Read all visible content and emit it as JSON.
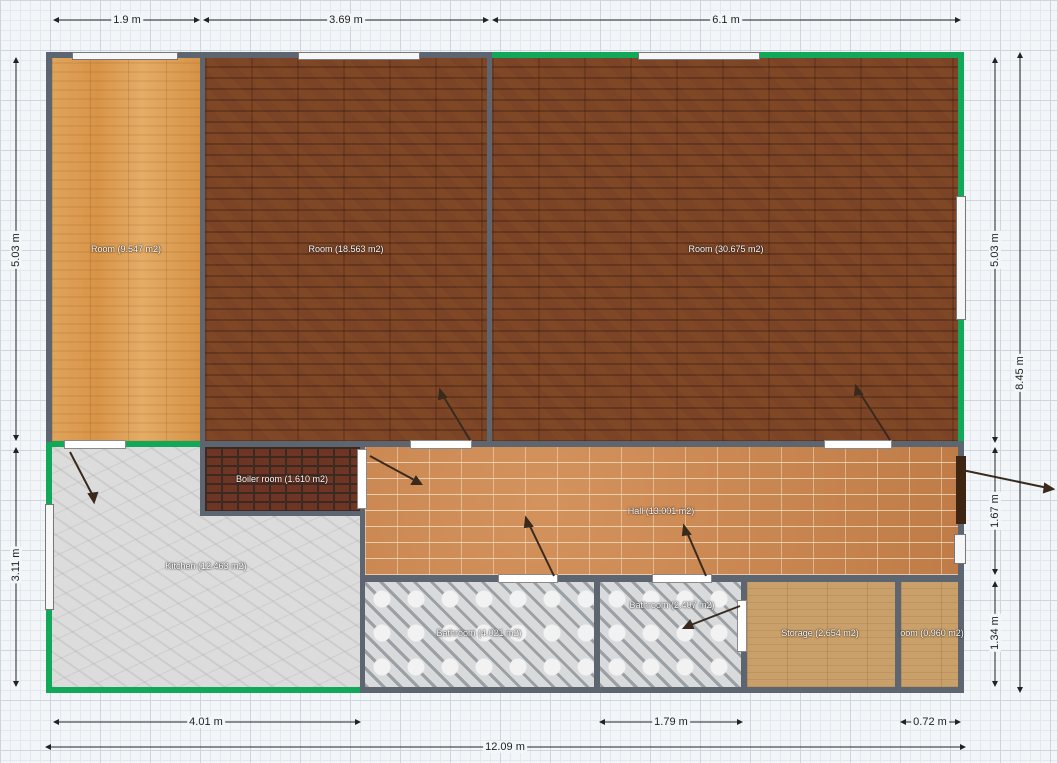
{
  "rooms": {
    "room_left": "Room (9.547 m2)",
    "room_middle": "Room (18.563 m2)",
    "room_right": "Room (30.675 m2)",
    "boiler": "Boiler room (1.610 m2)",
    "hall": "Hall (13.001 m2)",
    "kitchen": "Kitchen (12.463 m2)",
    "bathroom_1": "Bathroom (4.021 m2)",
    "bathroom_2": "Bathroom (2.407 m2)",
    "storage": "Storage (2.654 m2)",
    "room_small": "oom (0.960 m2)"
  },
  "dimensions": {
    "top_1": "1.9 m",
    "top_2": "3.69 m",
    "top_3": "6.1 m",
    "left_upper": "5.03 m",
    "left_lower": "3.11 m",
    "right_upper": "5.03 m",
    "right_total": "8.45 m",
    "right_hall": "1.67 m",
    "right_lower": "1.34 m",
    "bottom_kitchen": "4.01 m",
    "bottom_bath": "1.79 m",
    "bottom_small": "0.72 m",
    "bottom_total": "12.09 m"
  },
  "colors": {
    "wall": "#5d6670",
    "exterior_wall_highlight": "#12a85a",
    "background_grid": "#cdd6dd"
  }
}
